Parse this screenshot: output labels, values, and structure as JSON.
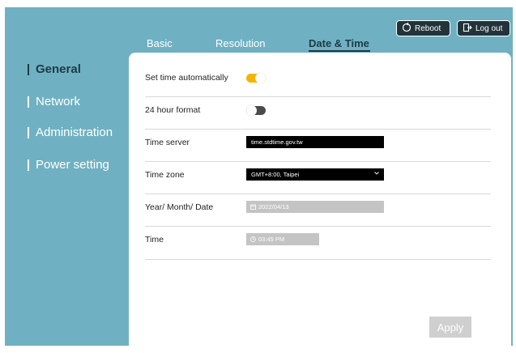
{
  "header": {
    "reboot_label": "Reboot",
    "logout_label": "Log out"
  },
  "tabs": [
    {
      "label": "Basic",
      "active": false
    },
    {
      "label": "Resolution",
      "active": false
    },
    {
      "label": "Date & Time",
      "active": true
    }
  ],
  "sidebar": {
    "items": [
      {
        "label": "General",
        "active": true
      },
      {
        "label": "Network",
        "active": false
      },
      {
        "label": "Administration",
        "active": false
      },
      {
        "label": "Power setting",
        "active": false
      }
    ]
  },
  "settings": {
    "auto_time": {
      "label": "Set time automatically",
      "enabled": true
    },
    "hour24": {
      "label": "24 hour format",
      "enabled": false
    },
    "time_server": {
      "label": "Time server",
      "value": "time.stdtime.gov.tw"
    },
    "time_zone": {
      "label": "Time zone",
      "value": "GMT+8:00, Taipei"
    },
    "date": {
      "label": "Year/ Month/ Date",
      "value": "2022/04/13"
    },
    "time": {
      "label": "Time",
      "value": "03:45 PM"
    }
  },
  "apply_label": "Apply",
  "colors": {
    "background": "#6fb1c2",
    "accent_toggle": "#f5b400",
    "active_text": "#1d3a45"
  }
}
